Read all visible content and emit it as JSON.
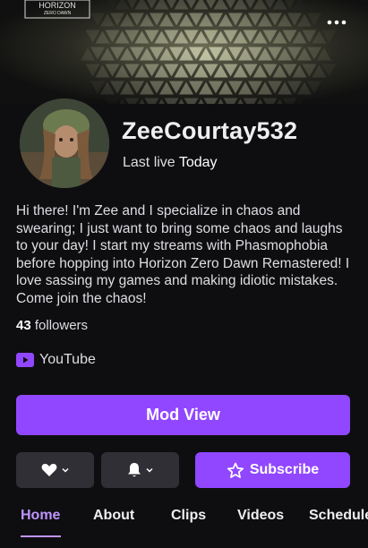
{
  "banner": {
    "logo_text": "HORIZON",
    "logo_subtext": "ZERO DAWN"
  },
  "channel": {
    "name": "ZeeCourtay532",
    "last_live_label": "Last live",
    "last_live_value": "Today",
    "bio": "Hi there! I'm Zee and I specialize in chaos and swearing; I just want to bring some chaos and laughs to your day! I start my streams with Phasmophobia before hopping into Horizon Zero Dawn Remastered! I love sassing my games and making idiotic mistakes. Come join the chaos!",
    "followers_count": "43",
    "followers_label": "followers"
  },
  "social": {
    "label": "YouTube",
    "icon": "youtube-icon",
    "color": "#9147ff"
  },
  "actions": {
    "mod_view_label": "Mod View",
    "subscribe_label": "Subscribe",
    "follow_icon": "heart-icon",
    "notification_icon": "bell-icon"
  },
  "tabs": [
    {
      "label": "Home",
      "active": true
    },
    {
      "label": "About",
      "active": false
    },
    {
      "label": "Clips",
      "active": false
    },
    {
      "label": "Videos",
      "active": false
    },
    {
      "label": "Schedule",
      "active": false
    }
  ],
  "colors": {
    "background": "#0e0e10",
    "accent": "#9147ff",
    "accent_light": "#bf94ff",
    "button_gray": "#2f2f35"
  }
}
